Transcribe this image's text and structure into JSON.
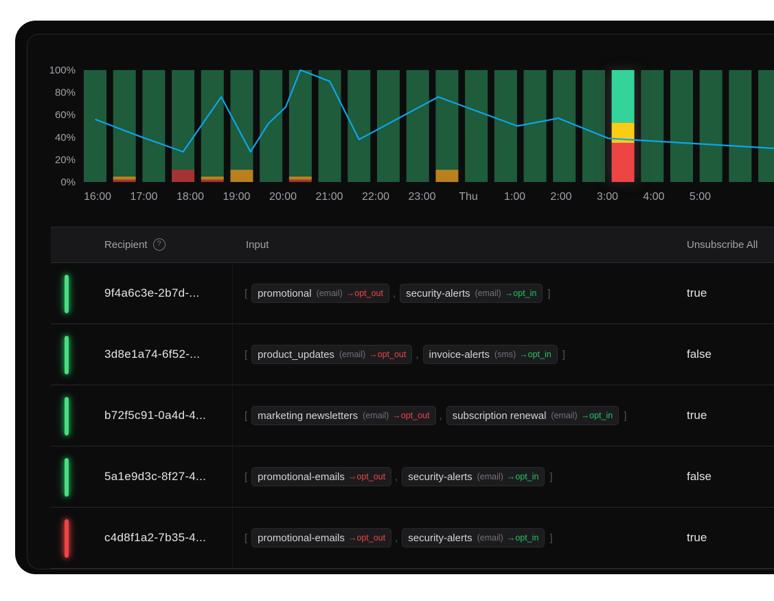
{
  "chart_data": {
    "type": "bar",
    "ylim": [
      0,
      100
    ],
    "y_ticks": [
      "100%",
      "80%",
      "60%",
      "40%",
      "20%",
      "0%"
    ],
    "x_labels": [
      "16:00",
      "17:00",
      "18:00",
      "19:00",
      "20:00",
      "21:00",
      "22:00",
      "23:00",
      "Thu",
      "1:00",
      "2:00",
      "3:00",
      "4:00",
      "5:00"
    ],
    "series": [
      {
        "name": "success",
        "color": "#1e5c3c",
        "values": [
          100,
          95,
          100,
          89,
          95,
          89,
          100,
          95,
          100,
          100,
          100,
          100,
          89,
          100,
          100,
          100,
          100,
          100,
          100,
          100,
          100,
          100,
          100,
          100,
          100,
          93
        ]
      },
      {
        "name": "warning",
        "color": "#b8801e",
        "values": [
          0,
          3,
          0,
          0,
          3,
          11,
          0,
          3,
          0,
          0,
          0,
          0,
          11,
          0,
          0,
          0,
          0,
          0,
          0,
          0,
          0,
          0,
          0,
          0,
          0,
          7
        ]
      },
      {
        "name": "error",
        "color": "#a63333",
        "values": [
          0,
          2,
          0,
          11,
          2,
          0,
          0,
          2,
          0,
          0,
          0,
          0,
          0,
          0,
          0,
          0,
          0,
          0,
          0,
          0,
          0,
          0,
          0,
          0,
          0,
          0
        ]
      }
    ],
    "highlight": {
      "index": 18,
      "green": 47,
      "yellow": 18,
      "red": 35
    },
    "line": {
      "color": "#0ea5e9",
      "points": [
        [
          0,
          56
        ],
        [
          1.5,
          41
        ],
        [
          3,
          27
        ],
        [
          4.3,
          76
        ],
        [
          5.3,
          27
        ],
        [
          5.9,
          52
        ],
        [
          6.5,
          67
        ],
        [
          7,
          100
        ],
        [
          8,
          90
        ],
        [
          9,
          38
        ],
        [
          11.7,
          76
        ],
        [
          14.4,
          50
        ],
        [
          15.8,
          57
        ],
        [
          17.5,
          39
        ],
        [
          23.2,
          30
        ],
        [
          24,
          35
        ]
      ]
    }
  },
  "table": {
    "headers": {
      "recipient": "Recipient",
      "help": "?",
      "input": "Input",
      "unsubscribe": "Unsubscribe All"
    },
    "rows": [
      {
        "status": "green",
        "id": "9f4a6c3e-2b7d-...",
        "unsubscribe": "true",
        "topics": [
          {
            "topic": "promotional",
            "channel": "(email)",
            "op": "→opt_out",
            "kind": "out"
          },
          {
            "topic": "security-alerts",
            "channel": "(email)",
            "op": "→opt_in",
            "kind": "in"
          }
        ]
      },
      {
        "status": "green",
        "id": "3d8e1a74-6f52-...",
        "unsubscribe": "false",
        "topics": [
          {
            "topic": "product_updates",
            "channel": "(email)",
            "op": "→opt_out",
            "kind": "out"
          },
          {
            "topic": "invoice-alerts",
            "channel": "(sms)",
            "op": "→opt_in",
            "kind": "in"
          }
        ]
      },
      {
        "status": "green",
        "id": "b72f5c91-0a4d-4...",
        "unsubscribe": "true",
        "topics": [
          {
            "topic": "marketing newsletters",
            "channel": "(email)",
            "op": "→opt_out",
            "kind": "out"
          },
          {
            "topic": "subscription renewal",
            "channel": "(email)",
            "op": "→opt_in",
            "kind": "in"
          }
        ]
      },
      {
        "status": "green",
        "id": "5a1e9d3c-8f27-4...",
        "unsubscribe": "false",
        "topics": [
          {
            "topic": "promotional-emails",
            "channel": "",
            "op": "→opt_out",
            "kind": "out"
          },
          {
            "topic": "security-alerts",
            "channel": "(email)",
            "op": "→opt_in",
            "kind": "in"
          }
        ]
      },
      {
        "status": "red",
        "id": "c4d8f1a2-7b35-4...",
        "unsubscribe": "true",
        "topics": [
          {
            "topic": "promotional-emails",
            "channel": "",
            "op": "→opt_out",
            "kind": "out"
          },
          {
            "topic": "security-alerts",
            "channel": "(email)",
            "op": "→opt_in",
            "kind": "in"
          }
        ]
      }
    ]
  },
  "brackets": {
    "open": "[",
    "close": "]",
    "sep": ","
  }
}
